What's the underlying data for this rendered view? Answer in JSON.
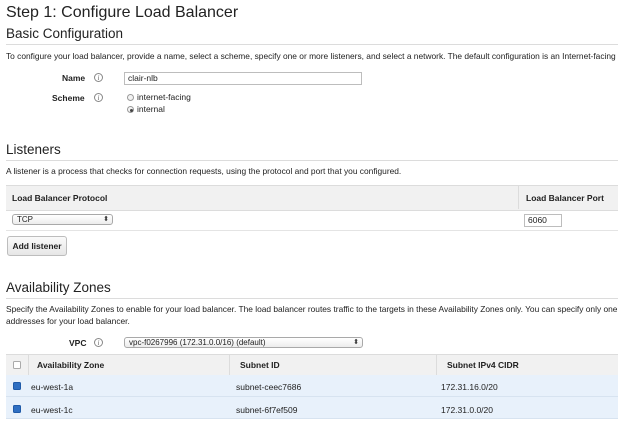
{
  "page": {
    "title": "Step 1: Configure Load Balancer"
  },
  "basic": {
    "heading": "Basic Configuration",
    "description": "To configure your load balancer, provide a name, select a scheme, specify one or more listeners, and select a network. The default configuration is an Internet-facing",
    "name_label": "Name",
    "name_value": "clair-nlb",
    "scheme_label": "Scheme",
    "scheme_options": [
      {
        "label": "internet-facing",
        "selected": false
      },
      {
        "label": "internal",
        "selected": true
      }
    ]
  },
  "listeners": {
    "heading": "Listeners",
    "description": "A listener is a process that checks for connection requests, using the protocol and port that you configured.",
    "col_protocol": "Load Balancer Protocol",
    "col_port": "Load Balancer Port",
    "rows": [
      {
        "protocol": "TCP",
        "port": "6060"
      }
    ],
    "add_button": "Add listener"
  },
  "az": {
    "heading": "Availability Zones",
    "description_line1": "Specify the Availability Zones to enable for your load balancer. The load balancer routes traffic to the targets in these Availability Zones only. You can specify only one",
    "description_line2": "addresses for your load balancer.",
    "vpc_label": "VPC",
    "vpc_value": "vpc-f0267996 (172.31.0.0/16) (default)",
    "col_zone": "Availability Zone",
    "col_subnet": "Subnet ID",
    "col_cidr": "Subnet IPv4 CIDR",
    "rows": [
      {
        "zone": "eu-west-1a",
        "subnet": "subnet-ceec7686",
        "cidr": "172.31.16.0/20",
        "checked": true
      },
      {
        "zone": "eu-west-1c",
        "subnet": "subnet-6f7ef509",
        "cidr": "172.31.0.0/20",
        "checked": true
      }
    ]
  },
  "icons": {
    "info": "i",
    "dropdown": "⬍"
  },
  "colors": {
    "selected_row": "#e8f1fb",
    "checkbox_checked": "#2f6fc2"
  }
}
